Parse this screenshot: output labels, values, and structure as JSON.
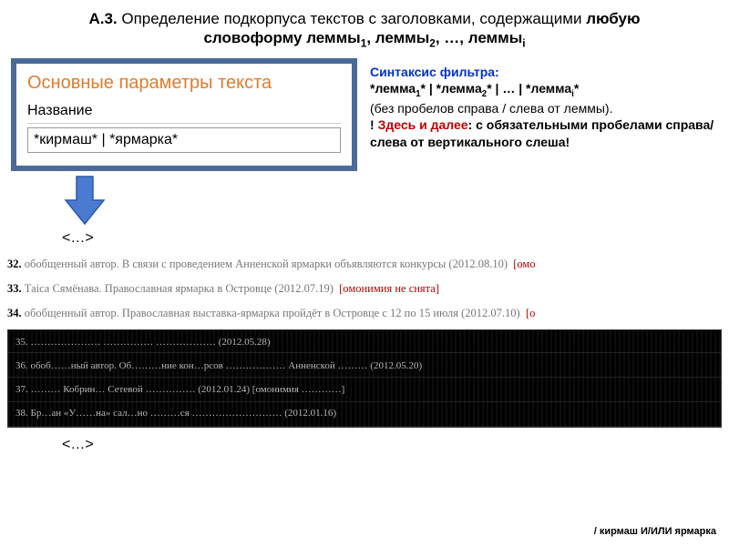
{
  "title": {
    "prefix": "А.3.",
    "line1_rest": " Определение подкорпуса текстов с заголовками, содержащими ",
    "bold_part": "любую словоформу леммы",
    "seq_mid": ", леммы",
    "seq_dots": ", …, леммы"
  },
  "form": {
    "heading": "Основные параметры текста",
    "label": "Название",
    "value": "*кирмаш* | *ярмарка*"
  },
  "syntax": {
    "label": "Синтаксис фильтра:",
    "pattern_a": "*лемма",
    "pattern_b": "* | *лемма",
    "pattern_c": "* | … | *лемма",
    "pattern_end": "*",
    "paren": "(без пробелов справа / слева от леммы).",
    "warn_pref": "! ",
    "warn_red": "Здесь и далее",
    "warn_rest": ": c обязательными пробелами справа/слева от вертикального слеша!"
  },
  "ellipsis": "<…>",
  "results": [
    {
      "n": "32.",
      "text": " обобщенный автор. В связи с проведением Анненской ярмарки объявляются конкурсы (2012.08.10)",
      "tag": "[омо"
    },
    {
      "n": "33.",
      "text": " Таіса Сямёнава. Православная ярмарка в Островце (2012.07.19)",
      "tag": "[омонимия не снята]"
    },
    {
      "n": "34.",
      "text": " обобщенный автор. Православная выставка-ярмарка пройдёт в Островце с 12 по 15 июля (2012.07.10)",
      "tag": "[о"
    }
  ],
  "corrupted_lines": [
    "35. ………………… …………… ……………… (2012.05.28)",
    "36. обоб……ный автор. Об………ние кон…рсов ……………… Анненской ……… (2012.05.20)",
    "37. ……… Кобрин… Сетевой …………… (2012.01.24)   [омонимия …………]",
    "38. Бр…ан «У……на» сал…но ………ся ……………………… (2012.01.16)"
  ],
  "footer": "/ кирмаш И/ИЛИ ярмарка"
}
